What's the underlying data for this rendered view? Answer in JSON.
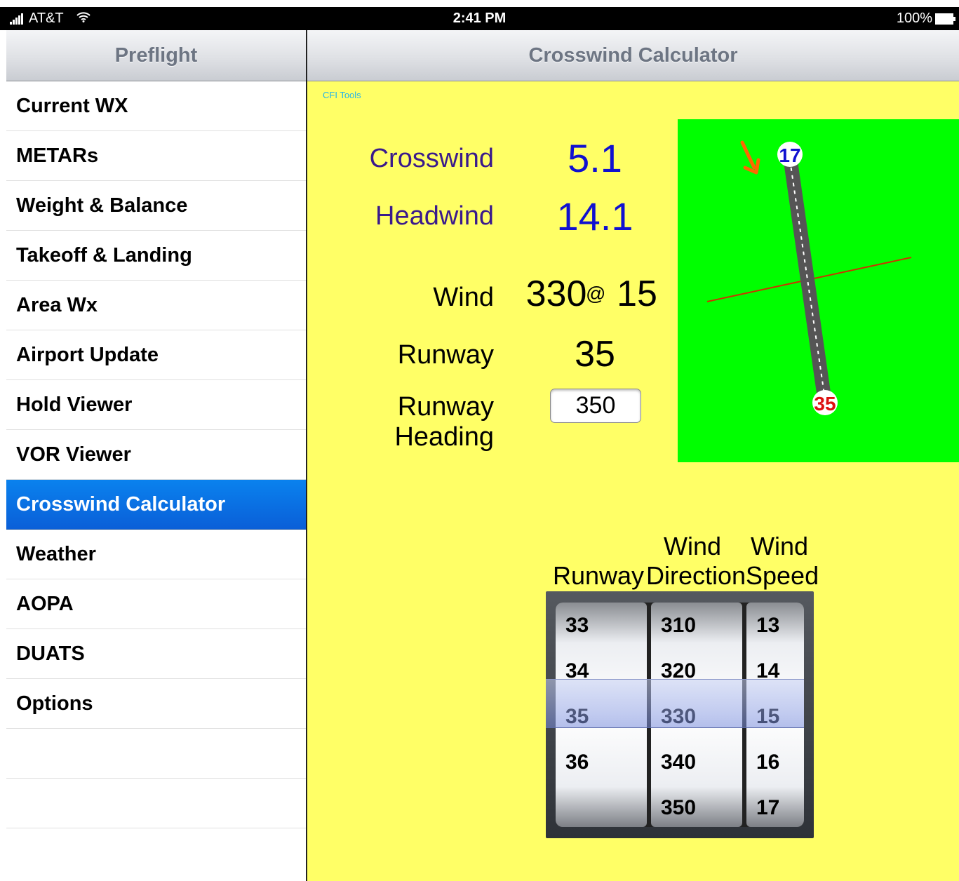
{
  "status_bar": {
    "carrier": "AT&T",
    "time": "2:41 PM",
    "battery": "100%"
  },
  "master": {
    "title": "Preflight",
    "items": [
      {
        "label": "Current WX"
      },
      {
        "label": "METARs"
      },
      {
        "label": "Weight & Balance"
      },
      {
        "label": "Takeoff & Landing"
      },
      {
        "label": "Area Wx"
      },
      {
        "label": "Airport Update"
      },
      {
        "label": "Hold Viewer"
      },
      {
        "label": "VOR Viewer"
      },
      {
        "label": "Crosswind Calculator"
      },
      {
        "label": "Weather"
      },
      {
        "label": "AOPA"
      },
      {
        "label": "DUATS"
      },
      {
        "label": "Options"
      }
    ],
    "selected_index": 8
  },
  "detail": {
    "title": "Crosswind Calculator",
    "brand": "CFI Tools",
    "crosswind_label": "Crosswind",
    "crosswind_value": "5.1",
    "headwind_label": "Headwind",
    "headwind_value": "14.1",
    "wind_label": "Wind",
    "wind_direction": "330",
    "wind_at": "@",
    "wind_speed": "15",
    "runway_label": "Runway",
    "runway_value": "35",
    "runway_heading_label": "Runway Heading",
    "runway_heading_value": "350",
    "diagram": {
      "runway_end_top": "17",
      "runway_end_bottom": "35",
      "background_color": "#00ff00",
      "arrow_color": "#ff6600",
      "crosswind_line_color": "#cc3300"
    },
    "picker": {
      "headers": {
        "runway": "Runway",
        "wind_direction_line1": "Wind",
        "wind_direction_line2": "Direction",
        "wind_speed_line1": "Wind",
        "wind_speed_line2": "Speed"
      },
      "runway_values": [
        "33",
        "34",
        "35",
        "36",
        ""
      ],
      "direction_values": [
        "310",
        "320",
        "330",
        "340",
        "350"
      ],
      "speed_values": [
        "13",
        "14",
        "15",
        "16",
        "17"
      ],
      "selected": {
        "runway": "35",
        "direction": "330",
        "speed": "15"
      }
    }
  }
}
